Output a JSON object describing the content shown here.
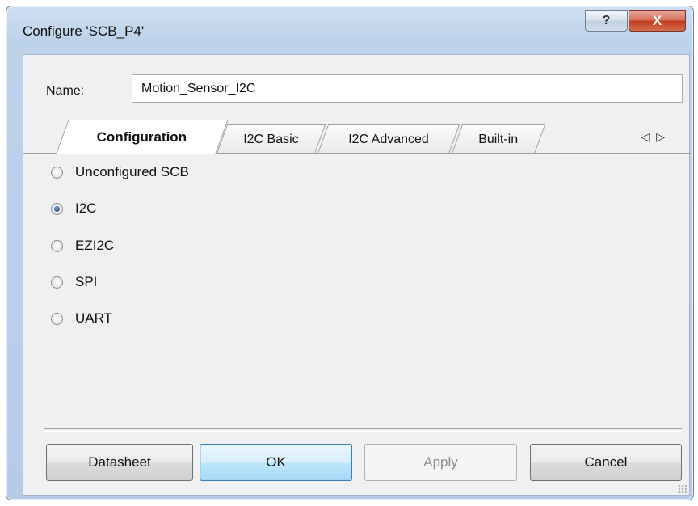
{
  "window": {
    "title": "Configure 'SCB_P4'",
    "help_glyph": "?",
    "close_glyph": "X"
  },
  "name_field": {
    "label": "Name:",
    "value": "Motion_Sensor_I2C"
  },
  "tabs": [
    {
      "label": "Configuration",
      "active": true
    },
    {
      "label": "I2C Basic",
      "active": false
    },
    {
      "label": "I2C Advanced",
      "active": false
    },
    {
      "label": "Built-in",
      "active": false
    }
  ],
  "tab_scroll": {
    "left": "◁",
    "right": "▷"
  },
  "modes": [
    {
      "label": "Unconfigured SCB",
      "checked": false
    },
    {
      "label": "I2C",
      "checked": true
    },
    {
      "label": "EZI2C",
      "checked": false
    },
    {
      "label": "SPI",
      "checked": false
    },
    {
      "label": "UART",
      "checked": false
    }
  ],
  "buttons": {
    "datasheet": "Datasheet",
    "ok": "OK",
    "apply": "Apply",
    "cancel": "Cancel"
  },
  "colors": {
    "frame": "#bed3ea",
    "close": "#c23c1e",
    "ok_button": "#bee6fd"
  }
}
